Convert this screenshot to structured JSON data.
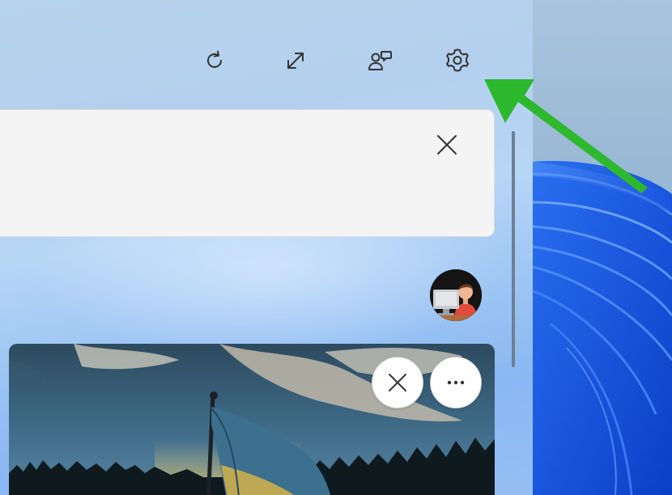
{
  "toolbar": {
    "icons": [
      "refresh-icon",
      "expand-icon",
      "people-chat-icon",
      "gear-icon"
    ]
  },
  "search_card": {
    "close_icon": "close-icon"
  },
  "news_card": {
    "image_desc_icon": "flag-photo",
    "dismiss_icon": "close-icon",
    "more_icon": "more-dots-icon"
  },
  "annotation": {
    "arrow_color": "#2eb82e"
  },
  "colors": {
    "panel_bg": "#b6d6f6",
    "card_bg": "#f4f4f4",
    "accent_blue": "#1e5fe0"
  }
}
